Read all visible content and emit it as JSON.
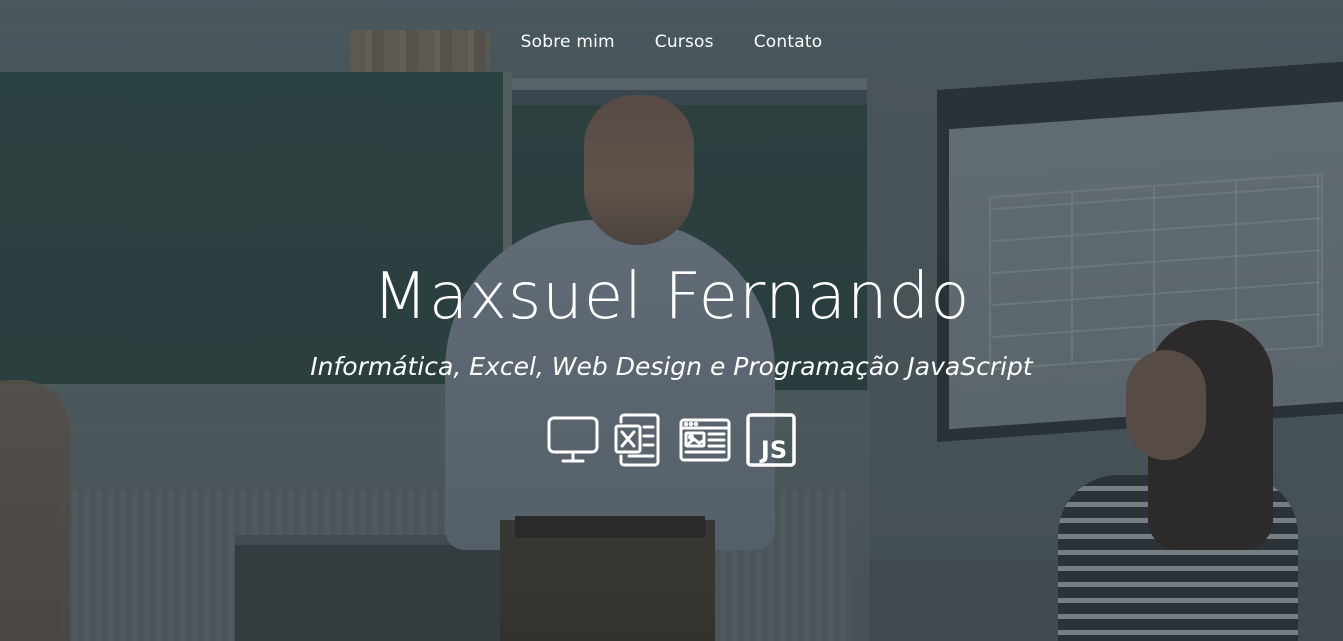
{
  "nav": {
    "items": [
      {
        "label": "Sobre mim"
      },
      {
        "label": "Cursos"
      },
      {
        "label": "Contato"
      }
    ]
  },
  "hero": {
    "title": "Maxsuel Fernando",
    "subtitle": "Informática, Excel, Web Design e Programação JavaScript",
    "icons": [
      "computer-icon",
      "excel-icon",
      "web-design-icon",
      "javascript-icon"
    ],
    "js_icon_text": "JS"
  },
  "colors": {
    "text": "#ffffff",
    "overlay": "#28343c"
  }
}
